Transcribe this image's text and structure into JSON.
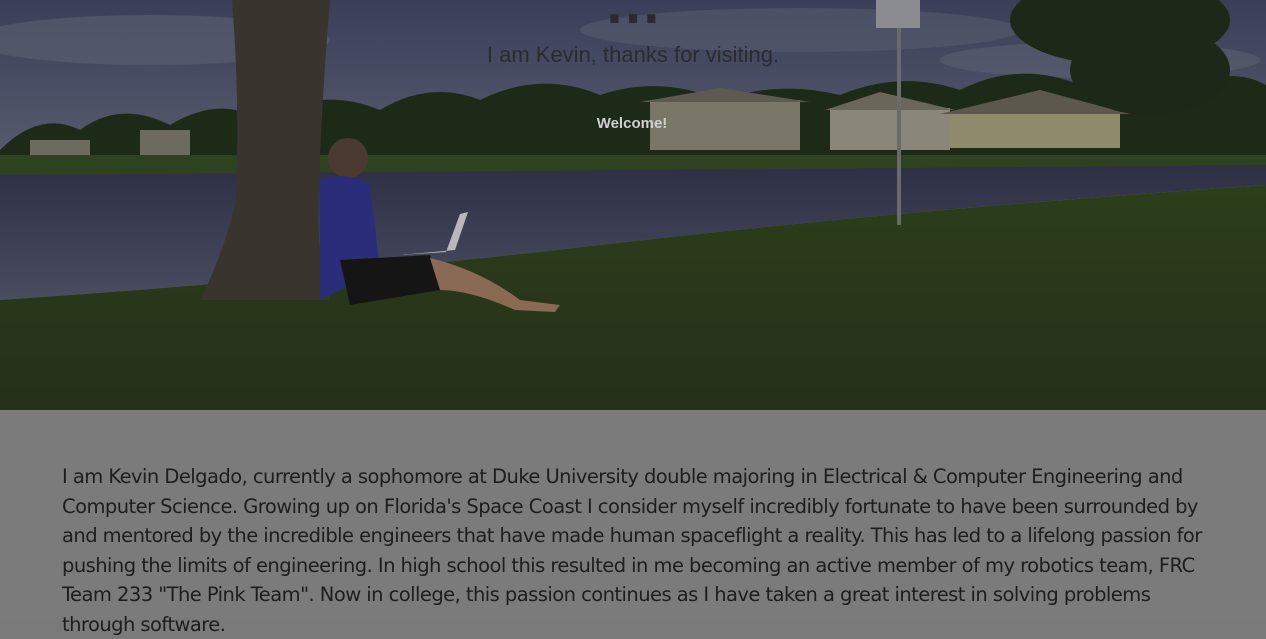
{
  "hero": {
    "title": "…",
    "subtitle": "I am Kevin, thanks for visiting.",
    "welcome_button": "Welcome!"
  },
  "about": {
    "paragraph": "I am Kevin Delgado, currently a sophomore at Duke University double majoring in Electrical & Computer Engineering and Computer Science. Growing up on Florida's Space Coast I consider myself incredibly fortunate to have been surrounded by and mentored by the incredible engineers that have made human spaceflight a reality. This has led to a lifelong passion for pushing the limits of engineering. In high school this resulted in me becoming an active member of my robotics team, FRC Team 233 \"The Pink Team\". Now in college, this passion continues as I have taken a great interest in solving problems through software."
  },
  "colors": {
    "sky": "#4a4f63",
    "water": "#3a3d52",
    "grass": "#2b3a1d",
    "about_bg": "#7b7b7b"
  }
}
